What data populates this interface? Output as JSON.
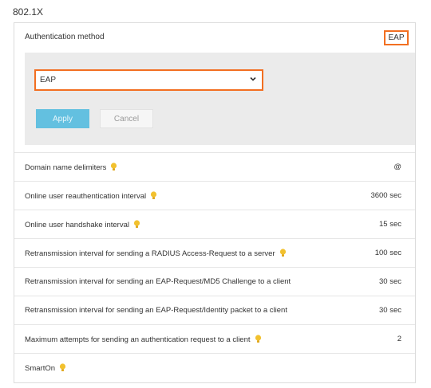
{
  "section": {
    "title": "802.1X"
  },
  "auth": {
    "label": "Authentication method",
    "value": "EAP"
  },
  "edit": {
    "select_value": "EAP",
    "apply_label": "Apply",
    "cancel_label": "Cancel"
  },
  "rows": [
    {
      "label": "Domain name delimiters",
      "value": "@"
    },
    {
      "label": "Online user reauthentication interval",
      "value": "3600 sec"
    },
    {
      "label": "Online user handshake interval",
      "value": "15 sec"
    },
    {
      "label": "Retransmission interval for sending a RADIUS Access-Request to a server",
      "value": "100 sec"
    },
    {
      "label": "Retransmission interval for sending an EAP-Request/MD5 Challenge to a client",
      "value": "30 sec"
    },
    {
      "label": "Retransmission interval for sending an EAP-Request/Identity packet to a client",
      "value": "30 sec"
    },
    {
      "label": "Maximum attempts for sending an authentication request to a client",
      "value": "2"
    },
    {
      "label": "SmartOn",
      "value": ""
    }
  ],
  "colors": {
    "highlight": "#f26f21",
    "apply_bg": "#63c0e0",
    "bulb": "#f2c12e"
  },
  "icons": {
    "bulb": "lightbulb-icon",
    "chevron": "chevron-down-icon"
  }
}
